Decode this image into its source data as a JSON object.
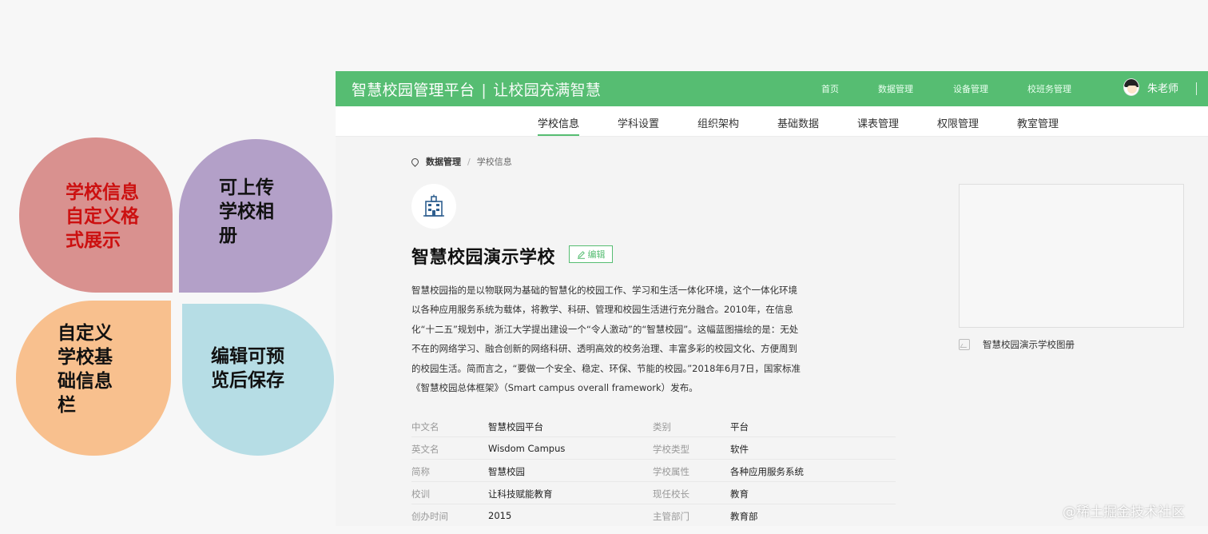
{
  "petals": [
    {
      "text": "学校信息\n自定义格\n式展示"
    },
    {
      "text": "可上传\n学校相\n册"
    },
    {
      "text": "自定义\n学校基\n础信息\n栏"
    },
    {
      "text": "编辑可预\n览后保存"
    }
  ],
  "header": {
    "brand": "智慧校园管理平台",
    "separator": "|",
    "slogan": "让校园充满智慧",
    "nav": [
      "首页",
      "数据管理",
      "设备管理",
      "校班务管理"
    ],
    "user": "朱老师"
  },
  "subnav": {
    "tabs": [
      "学校信息",
      "学科设置",
      "组织架构",
      "基础数据",
      "课表管理",
      "权限管理",
      "教室管理"
    ],
    "active": "学校信息"
  },
  "breadcrumb": {
    "level1": "数据管理",
    "separator": "/",
    "level2": "学校信息"
  },
  "school": {
    "name": "智慧校园演示学校",
    "edit_label": "编辑",
    "description_lines": [
      "智慧校园指的是以物联网为基础的智慧化的校园工作、学习和生活一体化环境，这个一体化环境",
      "以各种应用服务系统为载体，将教学、科研、管理和校园生活进行充分融合。2010年，在信息",
      "化“十二五”规划中，浙江大学提出建设一个“令人激动”的“智慧校园”。这幅蓝图描绘的是：无处",
      "不在的网络学习、融合创新的网络科研、透明高效的校务治理、丰富多彩的校园文化、方便周到",
      "的校园生活。简而言之，“要做一个安全、稳定、环保、节能的校园。”2018年6月7日，国家标准",
      "《智慧校园总体框架》（Smart campus overall framework）发布。"
    ],
    "info_rows": [
      {
        "k1": "中文名",
        "v1": "智慧校园平台",
        "k2": "类别",
        "v2": "平台"
      },
      {
        "k1": "英文名",
        "v1": "Wisdom Campus",
        "k2": "学校类型",
        "v2": "软件"
      },
      {
        "k1": "简称",
        "v1": "智慧校园",
        "k2": "学校属性",
        "v2": "各种应用服务系统"
      },
      {
        "k1": "校训",
        "v1": "让科技赋能教育",
        "k2": "现任校长",
        "v2": "教育"
      },
      {
        "k1": "创办时间",
        "v1": "2015",
        "k2": "主管部门",
        "v2": "教育部"
      }
    ],
    "album_caption": "智慧校园演示学校图册"
  },
  "watermark": "@稀土掘金技术社区",
  "colors": {
    "primary": "#56bd72",
    "petal_red": "#d9918f",
    "petal_purple": "#b3a0c8",
    "petal_orange": "#f8c08e",
    "petal_blue": "#b6dde5",
    "highlight_text": "#cc1010"
  }
}
